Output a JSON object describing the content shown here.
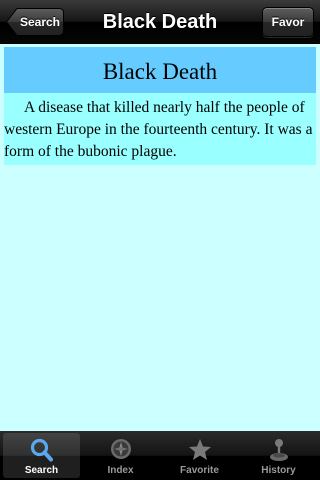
{
  "navbar": {
    "title": "Black Death",
    "back_label": "Search",
    "right_label": "Favor"
  },
  "article": {
    "title": "Black Death",
    "body": "A disease that killed nearly half the people of western Europe in the fourteenth century. It was a form of the bubonic plague."
  },
  "tabs": [
    {
      "label": "Search",
      "icon": "search-icon",
      "selected": true
    },
    {
      "label": "Index",
      "icon": "compass-icon",
      "selected": false
    },
    {
      "label": "Favorite",
      "icon": "star-icon",
      "selected": false
    },
    {
      "label": "History",
      "icon": "joystick-icon",
      "selected": false
    }
  ],
  "colors": {
    "background": "#ccffff",
    "body_background": "#99ffff",
    "title_background": "#66ccff",
    "tab_selected_icon": "#4a9ee6"
  }
}
